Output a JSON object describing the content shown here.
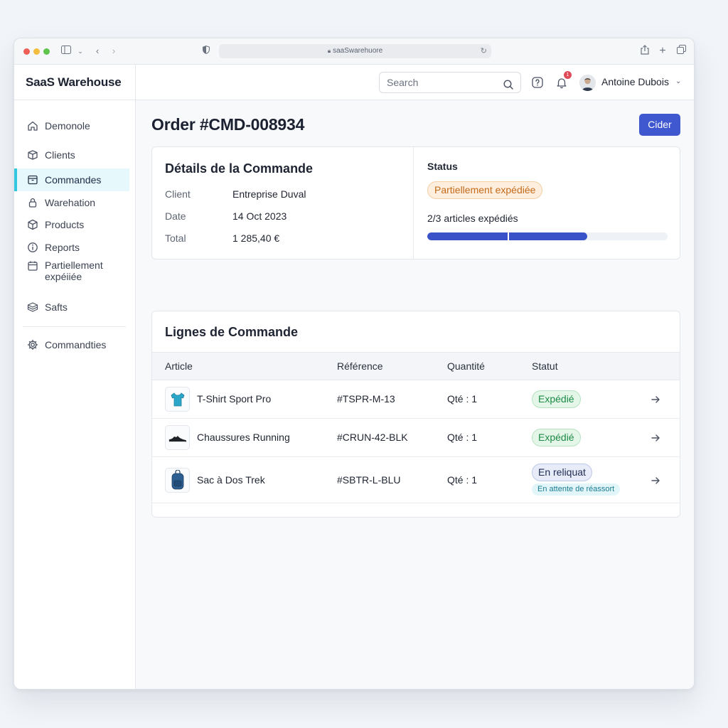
{
  "browser": {
    "url": "saaSwarehuore",
    "traffic_lights": [
      "#ee5f57",
      "#f4bd40",
      "#5ec44c"
    ]
  },
  "app": {
    "brand": "SaaS Warehouse"
  },
  "sidebar": {
    "items": [
      {
        "label": "Demonole",
        "icon": "home-icon"
      },
      {
        "label": "Clients",
        "icon": "box-icon"
      },
      {
        "label": "Commandes",
        "icon": "archive-icon",
        "active": true
      },
      {
        "label": "Warehation",
        "icon": "lock-icon"
      },
      {
        "label": "Products",
        "icon": "cube-icon"
      },
      {
        "label": "Reports",
        "icon": "info-icon"
      },
      {
        "label": "Partiellement expéiiée",
        "icon": "calendar-icon"
      },
      {
        "label": "Safts",
        "icon": "boxes-icon"
      },
      {
        "label": "Commandties",
        "icon": "gear-icon"
      }
    ]
  },
  "topbar": {
    "search_placeholder": "Search",
    "notification_count": "1",
    "user_name": "Antoine Dubois"
  },
  "page": {
    "title": "Order #CMD-008934",
    "primary_button": "Cider"
  },
  "details": {
    "title": "Détails de la Commande",
    "rows": [
      {
        "label": "Client",
        "value": "Entreprise Duval"
      },
      {
        "label": "Date",
        "value": "14 Oct 2023"
      },
      {
        "label": "Total",
        "value": "1 285,40 €"
      }
    ],
    "status_title": "Status",
    "status_badge": "Partiellement expédiée",
    "shipped_text": "2/3 articles expédiés",
    "shipped_fraction": 0.667
  },
  "lines": {
    "title": "Lignes de Commande",
    "headers": [
      "Article",
      "Référence",
      "Quantité",
      "Statut"
    ],
    "rows": [
      {
        "article": "T-Shirt Sport Pro",
        "reference": "#TSPR-M-13",
        "quantity": "Qté : 1",
        "status": "Expédié",
        "thumb": "tshirt-icon"
      },
      {
        "article": "Chaussures Running",
        "reference": "#CRUN-42-BLK",
        "quantity": "Qté : 1",
        "status": "Expédié",
        "thumb": "shoe-icon"
      },
      {
        "article": "Sac à Dos Trek",
        "reference": "#SBTR-L-BLU",
        "quantity": "Qté : 1",
        "status": "En reliquat",
        "substatus": "En attente de réassort",
        "thumb": "backpack-icon"
      }
    ]
  },
  "colors": {
    "accent": "#3f57cf",
    "active_nav": "#33c6e0",
    "badge_orange": "#c46b1a",
    "badge_green": "#1d8a45"
  }
}
